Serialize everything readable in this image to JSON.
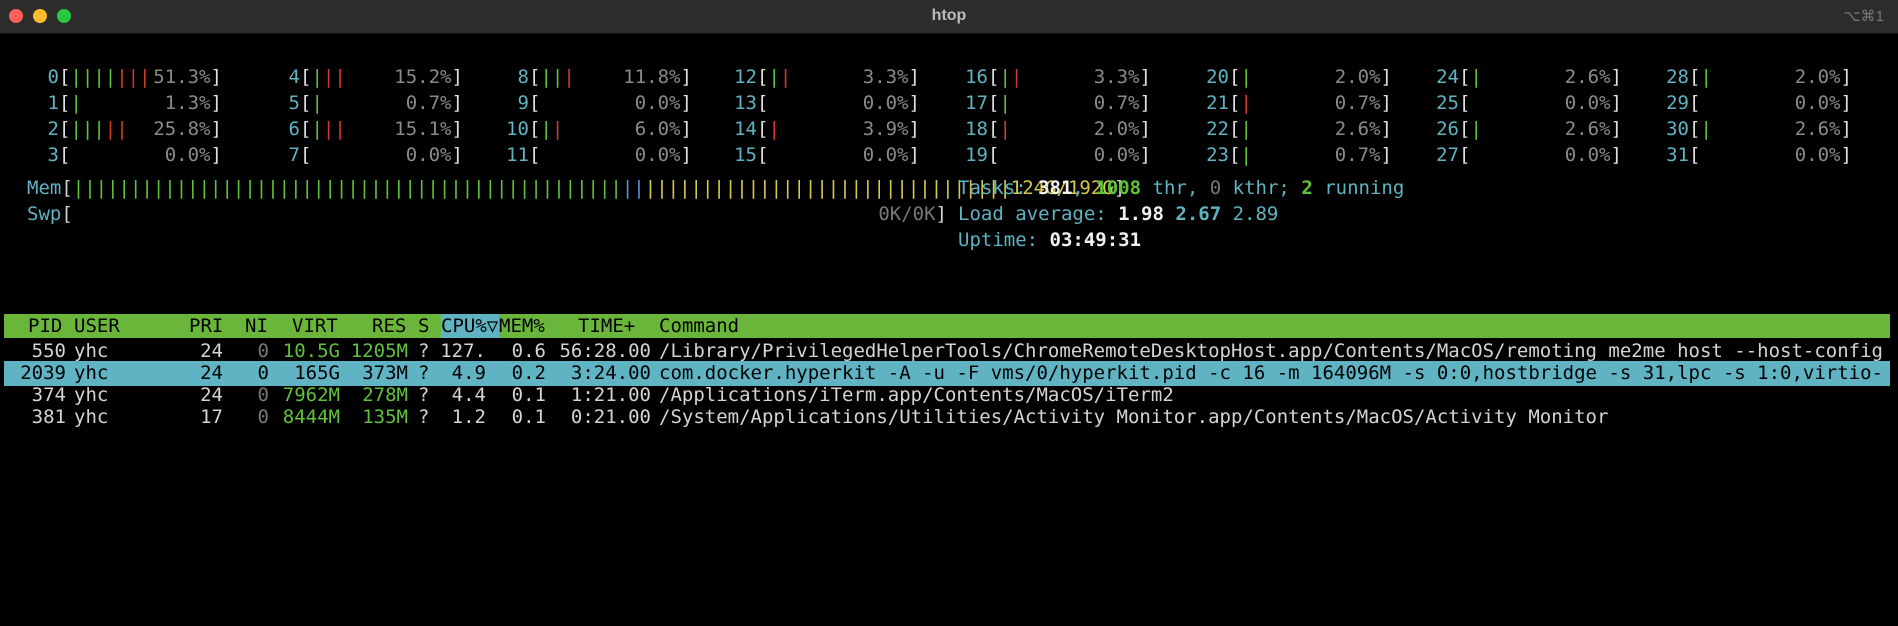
{
  "window": {
    "title": "htop",
    "shortcut": "⌥⌘1"
  },
  "cpus": [
    {
      "n": "0",
      "pct": "51.3%",
      "bars": [
        [
          "g",
          "||||"
        ],
        [
          "r",
          "|||"
        ]
      ]
    },
    {
      "n": "1",
      "pct": "1.3%",
      "bars": [
        [
          "g",
          "|"
        ]
      ]
    },
    {
      "n": "2",
      "pct": "25.8%",
      "bars": [
        [
          "g",
          "|||"
        ],
        [
          "r",
          "||"
        ]
      ]
    },
    {
      "n": "3",
      "pct": "0.0%",
      "bars": []
    },
    {
      "n": "4",
      "pct": "15.2%",
      "bars": [
        [
          "g",
          "|"
        ],
        [
          "r",
          "||"
        ]
      ]
    },
    {
      "n": "5",
      "pct": "0.7%",
      "bars": [
        [
          "g",
          "|"
        ]
      ]
    },
    {
      "n": "6",
      "pct": "15.1%",
      "bars": [
        [
          "g",
          "|"
        ],
        [
          "r",
          "||"
        ]
      ]
    },
    {
      "n": "7",
      "pct": "0.0%",
      "bars": []
    },
    {
      "n": "8",
      "pct": "11.8%",
      "bars": [
        [
          "g",
          "||"
        ],
        [
          "r",
          "|"
        ]
      ]
    },
    {
      "n": "9",
      "pct": "0.0%",
      "bars": []
    },
    {
      "n": "10",
      "pct": "6.0%",
      "bars": [
        [
          "g",
          "|"
        ],
        [
          "r",
          "|"
        ]
      ]
    },
    {
      "n": "11",
      "pct": "0.0%",
      "bars": []
    },
    {
      "n": "12",
      "pct": "3.3%",
      "bars": [
        [
          "g",
          "|"
        ],
        [
          "r",
          "|"
        ]
      ]
    },
    {
      "n": "13",
      "pct": "0.0%",
      "bars": []
    },
    {
      "n": "14",
      "pct": "3.9%",
      "bars": [
        [
          "r",
          "|"
        ]
      ]
    },
    {
      "n": "15",
      "pct": "0.0%",
      "bars": []
    },
    {
      "n": "16",
      "pct": "3.3%",
      "bars": [
        [
          "g",
          "|"
        ],
        [
          "r",
          "|"
        ]
      ]
    },
    {
      "n": "17",
      "pct": "0.7%",
      "bars": [
        [
          "g",
          "|"
        ]
      ]
    },
    {
      "n": "18",
      "pct": "2.0%",
      "bars": [
        [
          "r",
          "|"
        ]
      ]
    },
    {
      "n": "19",
      "pct": "0.0%",
      "bars": []
    },
    {
      "n": "20",
      "pct": "2.0%",
      "bars": [
        [
          "g",
          "|"
        ]
      ]
    },
    {
      "n": "21",
      "pct": "0.7%",
      "bars": [
        [
          "r",
          "|"
        ]
      ]
    },
    {
      "n": "22",
      "pct": "2.6%",
      "bars": [
        [
          "g",
          "|"
        ]
      ]
    },
    {
      "n": "23",
      "pct": "0.7%",
      "bars": [
        [
          "g",
          "|"
        ]
      ]
    },
    {
      "n": "24",
      "pct": "2.6%",
      "bars": [
        [
          "g",
          "|"
        ]
      ]
    },
    {
      "n": "25",
      "pct": "0.0%",
      "bars": []
    },
    {
      "n": "26",
      "pct": "2.6%",
      "bars": [
        [
          "g",
          "|"
        ]
      ]
    },
    {
      "n": "27",
      "pct": "0.0%",
      "bars": []
    },
    {
      "n": "28",
      "pct": "2.0%",
      "bars": [
        [
          "g",
          "|"
        ]
      ]
    },
    {
      "n": "29",
      "pct": "0.0%",
      "bars": []
    },
    {
      "n": "30",
      "pct": "2.6%",
      "bars": [
        [
          "g",
          "|"
        ]
      ]
    },
    {
      "n": "31",
      "pct": "0.0%",
      "bars": []
    }
  ],
  "mem": {
    "label": "Mem",
    "value": "124G/192G"
  },
  "swp": {
    "label": "Swp",
    "value": "0K/0K"
  },
  "tasks": {
    "label": "Tasks:",
    "count": "381",
    "thr": "1008",
    "thr_label": "thr,",
    "kthr": "0",
    "kthr_label": "kthr;",
    "running": "2",
    "running_label": "running"
  },
  "load": {
    "label": "Load average:",
    "l1": "1.98",
    "l5": "2.67",
    "l15": "2.89"
  },
  "uptime": {
    "label": "Uptime:",
    "value": "03:49:31"
  },
  "columns": [
    "PID",
    "USER",
    "PRI",
    "NI",
    "VIRT",
    "RES",
    "S",
    "CPU%▽",
    "MEM%",
    "TIME+",
    "Command"
  ],
  "processes": [
    {
      "pid": "550",
      "user": "yhc",
      "pri": "24",
      "ni": "0",
      "virt": "10.5G",
      "res": "1205M",
      "s": "?",
      "cpu": "127.",
      "mem": "0.6",
      "time": "56:28.00",
      "cmd": "/Library/PrivilegedHelperTools/ChromeRemoteDesktopHost.app/Contents/MacOS/remoting_me2me_host --host-config"
    },
    {
      "pid": "2039",
      "user": "yhc",
      "pri": "24",
      "ni": "0",
      "virt": "165G",
      "res": "373M",
      "s": "?",
      "cpu": "4.9",
      "mem": "0.2",
      "time": "3:24.00",
      "cmd": "com.docker.hyperkit -A -u -F vms/0/hyperkit.pid -c 16 -m 164096M -s 0:0,hostbridge -s 31,lpc -s 1:0,virtio-"
    },
    {
      "pid": "374",
      "user": "yhc",
      "pri": "24",
      "ni": "0",
      "virt": "7962M",
      "res": "278M",
      "s": "?",
      "cpu": "4.4",
      "mem": "0.1",
      "time": "1:21.00",
      "cmd": "/Applications/iTerm.app/Contents/MacOS/iTerm2"
    },
    {
      "pid": "381",
      "user": "yhc",
      "pri": "17",
      "ni": "0",
      "virt": "8444M",
      "res": "135M",
      "s": "?",
      "cpu": "1.2",
      "mem": "0.1",
      "time": "0:21.00",
      "cmd": "/System/Applications/Utilities/Activity Monitor.app/Contents/MacOS/Activity Monitor"
    }
  ]
}
